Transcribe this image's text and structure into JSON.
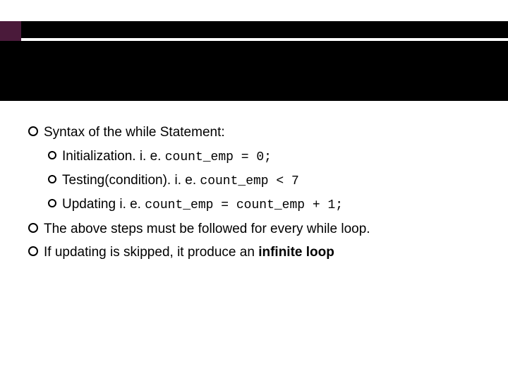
{
  "bullets": {
    "b1": "Syntax of the while Statement:",
    "b1a_label": "Initialization",
    "b1a_mid": ". i. e. ",
    "b1a_code": "count_emp = 0;",
    "b1b_label": "Testing(condition)",
    "b1b_mid": ". i. e. ",
    "b1b_code": "count_emp < 7",
    "b1c_label": "Updating",
    "b1c_mid": " i. e. ",
    "b1c_code": "count_emp = count_emp + 1;",
    "b2": "The above steps must be followed for every while loop.",
    "b3_pre": "If updating is skipped, it produce an ",
    "b3_bold": "infinite loop"
  }
}
